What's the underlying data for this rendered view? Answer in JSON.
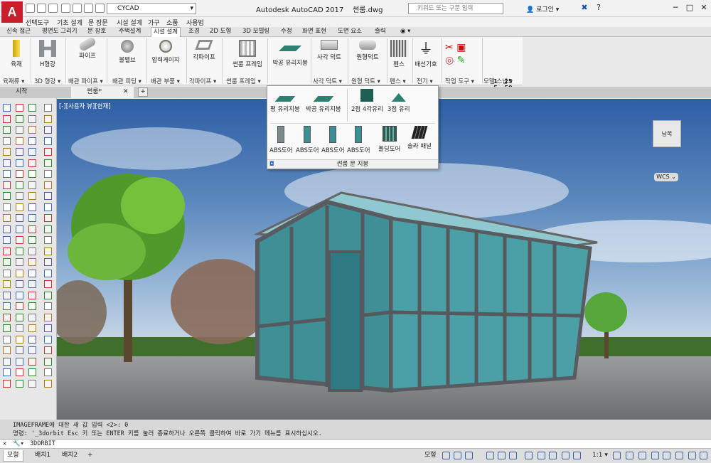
{
  "title": {
    "app": "Autodesk AutoCAD 2017",
    "file": "썬룸.dwg",
    "workspace": "CYCAD",
    "search_placeholder": "키워드 또는 구문 입력",
    "login": "로그인"
  },
  "logo": "A",
  "menus": [
    "선택도구",
    "기초 설계",
    "문 장문",
    "시설 설계",
    "가구",
    "소품",
    "사용법"
  ],
  "ribbon_tabs": [
    "신속 접근",
    "평면도 그리기",
    "문 창호",
    "주택설계",
    "시설 설계",
    "조경",
    "2D 도형",
    "3D 모델링",
    "수정",
    "화면 표현",
    "도면 요소",
    "출력"
  ],
  "active_tab_index": 4,
  "tools": [
    {
      "label": "육재",
      "icon": "post-icon"
    },
    {
      "label": "H형강",
      "icon": "h-beam-icon"
    },
    {
      "label": "파이프",
      "icon": "pipe-icon"
    },
    {
      "label": "볼밸브",
      "icon": "ball-valve-icon"
    },
    {
      "label": "압력게이지",
      "icon": "pressure-gauge-icon"
    },
    {
      "label": "각파이프",
      "icon": "square-pipe-icon"
    },
    {
      "label": "썬룸 프레임",
      "icon": "sunroom-frame-icon"
    },
    {
      "label": "박공 유리지붕",
      "icon": "gable-glass-roof-icon"
    },
    {
      "label": "사각 덕트",
      "icon": "square-duct-icon"
    },
    {
      "label": "원형덕트",
      "icon": "round-duct-icon"
    },
    {
      "label": "펜스",
      "icon": "fence-icon"
    },
    {
      "label": "배선기호",
      "icon": "wiring-symbol-icon"
    }
  ],
  "groups": [
    "육재류 ▾",
    "3D 형강 ▾",
    "배관 파이프 ▾",
    "배관 피팅 ▾",
    "배관 부품 ▾",
    "각파이프 ▾",
    "썬룸 프레임 ▾",
    "사각 덕트 ▾",
    "원형 덕트 ▾",
    "펜스 ▾",
    "전기 ▾",
    "작업 도구 ▾",
    "모델 스냅 ▾"
  ],
  "scale_values": [
    "1",
    "25",
    "5",
    "50",
    "10",
    "100"
  ],
  "doc_tabs": [
    "시작",
    "썬룸*"
  ],
  "viewport_label": "[-][사용자 뷰][현재]",
  "viewcube": {
    "face": "남쪽",
    "wcs": "WCS ⌄"
  },
  "popup": {
    "row1": [
      "평 유리지붕",
      "박공 유리지붕",
      "2점 4각유리",
      "3점 유리"
    ],
    "row2": [
      "ABS도어",
      "ABS도어",
      "ABS도어",
      "ABS도어",
      "폴딩도어",
      "솔라 패널"
    ],
    "footer": "썬룸 문 지붕"
  },
  "command": {
    "history1": "IMAGEFRAME에 대한 새 값 입력 <2>: 0",
    "history2": "명령: '_3dorbit Esc 키 또는 ENTER 키를 눌러 종료하거나 오른쪽 클릭하여 바로 가기 메뉴를 표시하십시오.",
    "current": "3DORBIT"
  },
  "layout_tabs": [
    "모형",
    "배치1",
    "배치2"
  ],
  "status": {
    "mode": "모형",
    "scale": "1:1 ▾"
  },
  "colors": {
    "accent": "#c8202a",
    "sky": "#4e7db5",
    "frame": "#555a5e",
    "glass": "#4fa7a8"
  }
}
